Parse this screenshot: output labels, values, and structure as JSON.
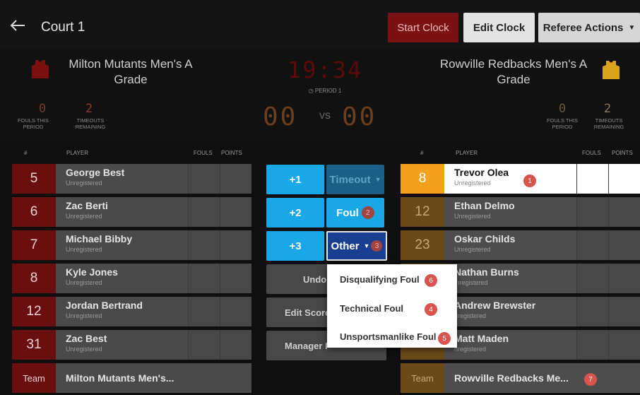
{
  "topbar": {
    "court_title": "Court 1",
    "start_clock": "Start Clock",
    "edit_clock": "Edit Clock",
    "referee_actions": "Referee Actions"
  },
  "home": {
    "name": "Milton Mutants Men's A Grade",
    "jersey_color": "#8b1212",
    "fouls_value": "0",
    "fouls_label": "FOULS THIS PERIOD",
    "timeouts_value": "2",
    "timeouts_label": "TIMEOUTS REMAINING",
    "score": "00",
    "players": [
      {
        "number": "5",
        "name": "George Best",
        "status": "Unregistered"
      },
      {
        "number": "6",
        "name": "Zac Berti",
        "status": "Unregistered"
      },
      {
        "number": "7",
        "name": "Michael Bibby",
        "status": "Unregistered"
      },
      {
        "number": "8",
        "name": "Kyle Jones",
        "status": "Unregistered"
      },
      {
        "number": "12",
        "name": "Jordan Bertrand",
        "status": "Unregistered"
      },
      {
        "number": "31",
        "name": "Zac Best",
        "status": "Unregistered"
      }
    ],
    "team_row": {
      "label": "Team",
      "name": "Milton Mutants Men's..."
    }
  },
  "away": {
    "name": "Rowville Redbacks Men's A Grade",
    "jersey_color": "#d9a21c",
    "fouls_value": "0",
    "fouls_label": "FOULS THIS PERIOD",
    "timeouts_value": "2",
    "timeouts_label": "TIMEOUTS REMAINING",
    "score": "00",
    "players": [
      {
        "number": "8",
        "name": "Trevor Olea",
        "status": "Unregistered"
      },
      {
        "number": "12",
        "name": "Ethan Delmo",
        "status": "Unregistered"
      },
      {
        "number": "23",
        "name": "Oskar Childs",
        "status": "Unregistered"
      },
      {
        "number": "",
        "name": "Nathan Burns",
        "status": "Inregistered"
      },
      {
        "number": "",
        "name": "Andrew Brewster",
        "status": "nregistered"
      },
      {
        "number": "",
        "name": "Matt Maden",
        "status": "nregistered"
      }
    ],
    "team_row": {
      "label": "Team",
      "name": "Rowville Redbacks Me..."
    }
  },
  "clock": {
    "time": "19:34",
    "period": "PERIOD 1",
    "vs": "VS"
  },
  "columns": {
    "number": "#",
    "player": "PLAYER",
    "fouls": "FOULS",
    "points": "POINTS"
  },
  "actions": {
    "plus1": "+1",
    "plus2": "+2",
    "plus3": "+3",
    "timeout": "Timeout",
    "foul": "Foul",
    "other": "Other",
    "undo": "Undo",
    "edit_score": "Edit Score",
    "manager": "Manager I"
  },
  "other_menu": {
    "items": [
      "Disqualifying Foul",
      "Technical Foul",
      "Unsportsmanlike Foul"
    ]
  },
  "badges": {
    "b1": "1",
    "b2": "2",
    "b3": "3",
    "b4": "4",
    "b5": "5",
    "b6": "6",
    "b7": "7"
  }
}
